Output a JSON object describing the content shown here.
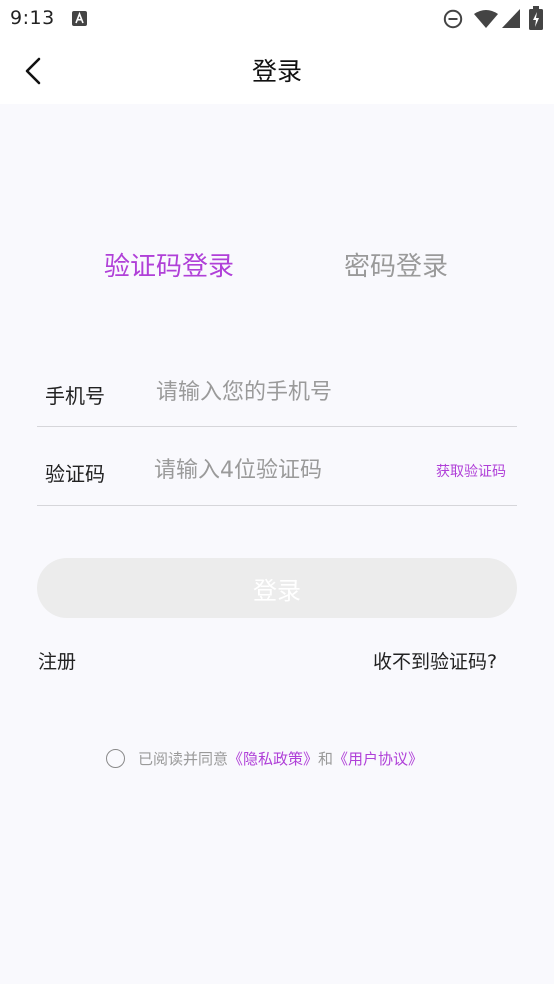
{
  "status_bar": {
    "time": "9:13",
    "icons": [
      "text-a-icon",
      "do-not-disturb-icon",
      "wifi-icon",
      "signal-icon",
      "battery-charging-icon"
    ]
  },
  "nav": {
    "title": "登录",
    "back_icon": "chevron-left-icon"
  },
  "tabs": [
    {
      "label": "验证码登录",
      "active": true
    },
    {
      "label": "密码登录",
      "active": false
    }
  ],
  "form": {
    "phone_label": "手机号",
    "phone_placeholder": "请输入您的手机号",
    "phone_value": "",
    "code_label": "验证码",
    "code_placeholder": "请输入4位验证码",
    "code_value": "",
    "get_code_label": "获取验证码"
  },
  "login_button_label": "登录",
  "links": {
    "register": "注册",
    "no_code": "收不到验证码?"
  },
  "agreement": {
    "checked": false,
    "prefix": "已阅读并同意",
    "privacy": "《隐私政策》",
    "and": "和",
    "user_agreement": "《用户协议》"
  },
  "colors": {
    "accent": "#b040d8",
    "background": "#f9f9fd",
    "muted_text": "#9a9a9a",
    "disabled_button": "#ececec"
  }
}
